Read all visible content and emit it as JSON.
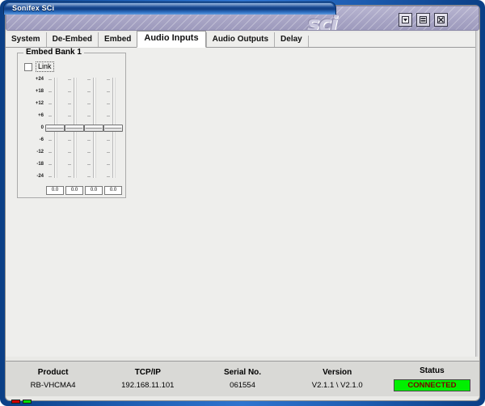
{
  "window": {
    "title": "Sonifex SCi",
    "logo_text": "sci",
    "buttons": {
      "minimize": "minimize-icon",
      "maximize": "maximize-icon",
      "close": "close-icon"
    }
  },
  "tabs": [
    {
      "label": "System",
      "active": false
    },
    {
      "label": "De-Embed",
      "active": false
    },
    {
      "label": "Embed",
      "active": false
    },
    {
      "label": "Audio Inputs",
      "active": true
    },
    {
      "label": "Audio Outputs",
      "active": false
    },
    {
      "label": "Delay",
      "active": false
    }
  ],
  "panel": {
    "title": "Embed Bank 1",
    "link": {
      "label": "Link",
      "checked": false
    },
    "scale_labels": [
      "+24",
      "+18",
      "+12",
      "+6",
      "0",
      "-6",
      "-12",
      "-18",
      "-24"
    ],
    "faders": [
      {
        "name": "channel-1",
        "value": "0.0"
      },
      {
        "name": "channel-2",
        "value": "0.0"
      },
      {
        "name": "channel-3",
        "value": "0.0"
      },
      {
        "name": "channel-4",
        "value": "0.0"
      }
    ]
  },
  "statusbar": {
    "columns": [
      {
        "head": "Product",
        "value": "RB-VHCMA4"
      },
      {
        "head": "TCP/IP",
        "value": "192.168.11.101"
      },
      {
        "head": "Serial No.",
        "value": "061554"
      },
      {
        "head": "Version",
        "value": "V2.1.1 \\ V2.1.0"
      },
      {
        "head": "Status",
        "value": "CONNECTED"
      }
    ],
    "status_color": "#00f000",
    "status_text_color": "#7a0000"
  },
  "leds": [
    {
      "name": "led-red",
      "color": "#d00000"
    },
    {
      "name": "led-green",
      "color": "#00e000"
    }
  ]
}
